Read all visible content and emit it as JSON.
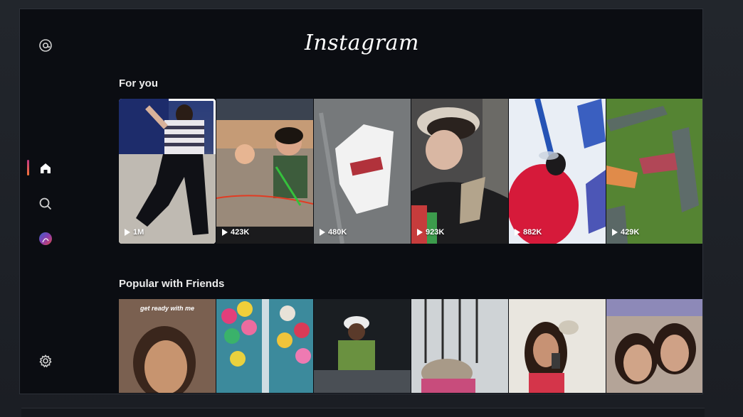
{
  "app": {
    "brand": "Instagram"
  },
  "sidebar": {
    "items": [
      {
        "name": "threads-icon",
        "active": false
      },
      {
        "name": "home-icon",
        "active": true
      },
      {
        "name": "search-icon",
        "active": false
      },
      {
        "name": "avatar",
        "active": false
      },
      {
        "name": "settings-icon",
        "active": false
      }
    ],
    "accent": "#c13584"
  },
  "sections": {
    "for_you": {
      "title": "For you",
      "tiles": [
        {
          "count": "1M",
          "selected": true
        },
        {
          "count": "423K"
        },
        {
          "count": "480K"
        },
        {
          "count": "923K"
        },
        {
          "count": "882K"
        },
        {
          "count": "429K"
        }
      ]
    },
    "popular": {
      "title": "Popular with Friends",
      "tiles": [
        {
          "caption": "get ready with me"
        },
        {},
        {},
        {},
        {},
        {}
      ]
    }
  }
}
